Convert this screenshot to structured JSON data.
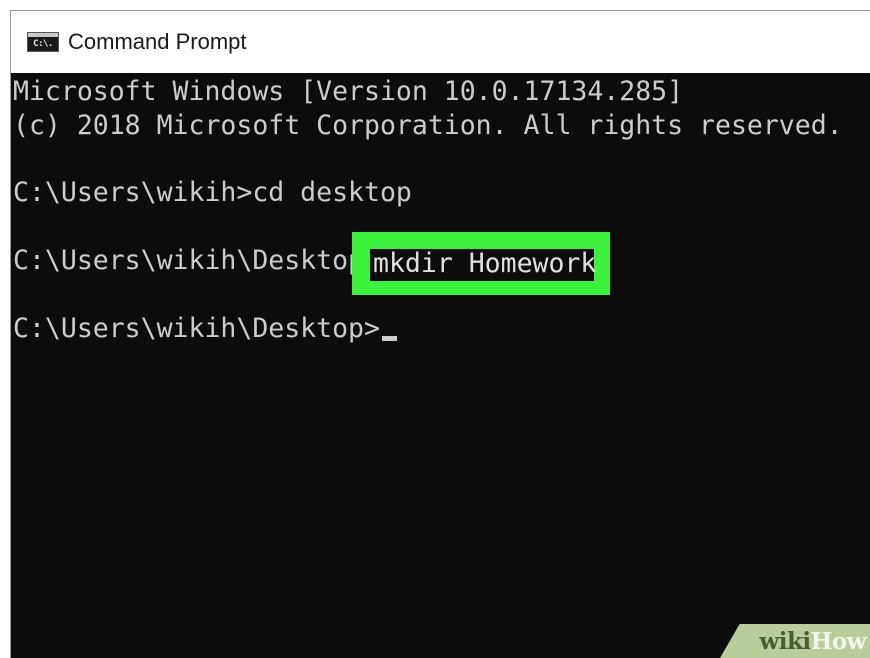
{
  "window": {
    "title": "Command Prompt",
    "icon": "cmd-icon",
    "icon_glyph": "C:\\."
  },
  "console": {
    "lines": [
      "Microsoft Windows [Version 10.0.17134.285]",
      "(c) 2018 Microsoft Corporation. All rights reserved.",
      "C:\\Users\\wikih>cd desktop",
      "C:\\Users\\wikih\\Desktop>",
      "C:\\Users\\wikih\\Desktop>"
    ],
    "highlighted_command": "mkdir Homework",
    "highlight_color": "#3ef03e"
  },
  "watermark": {
    "wiki": "wiki",
    "how": "How"
  }
}
